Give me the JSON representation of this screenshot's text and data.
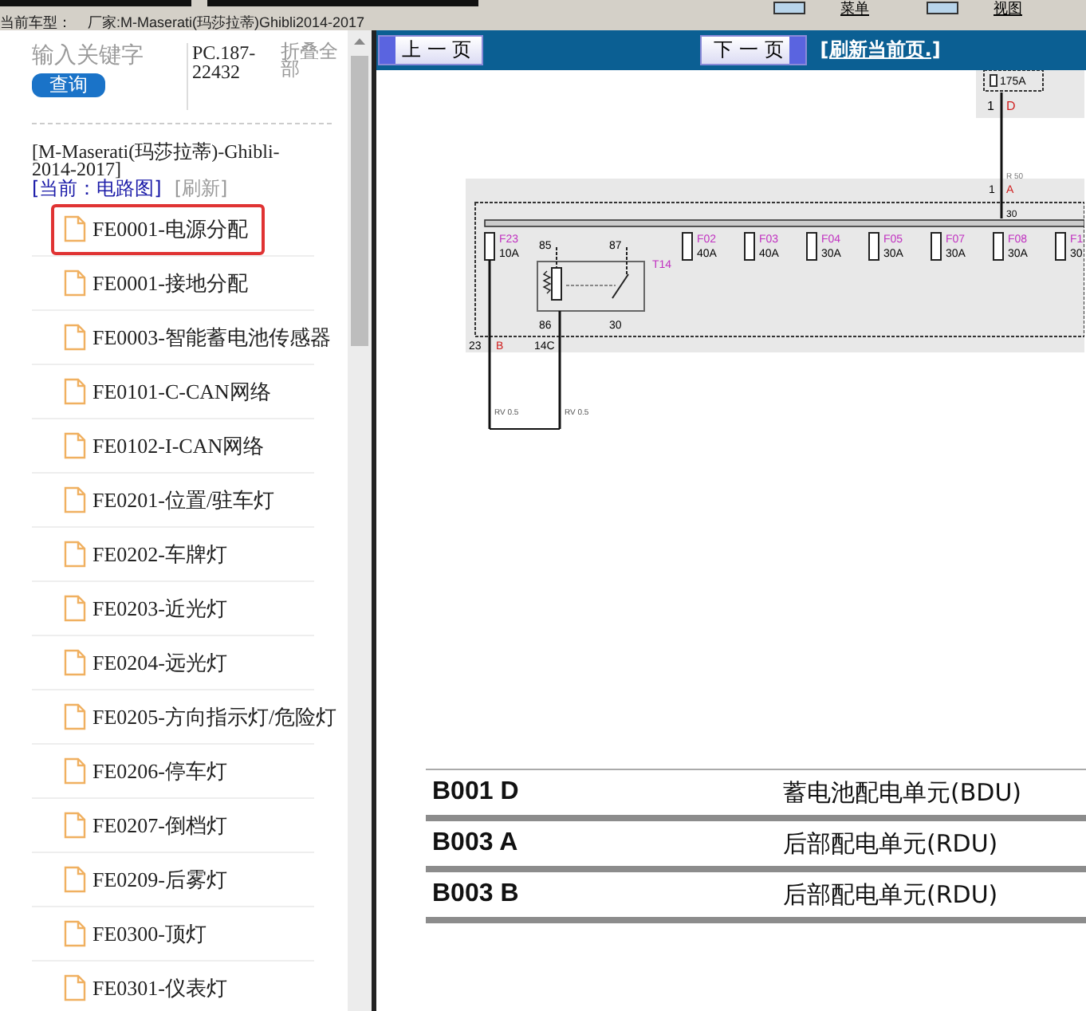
{
  "toolbar": {
    "buttons": [
      {
        "label": "菜单"
      },
      {
        "label": "视图"
      }
    ]
  },
  "vehicle_line": {
    "label": "当前车型：",
    "value": "厂家:M-Maserati(玛莎拉蒂)Ghibli2014-2017"
  },
  "sidebar": {
    "search_placeholder": "输入关键字",
    "search_button": "查询",
    "code": "PC.187-22432",
    "collapse_all": "折叠全部",
    "model_title": "[M-Maserati(玛莎拉蒂)-Ghibli-2014-2017]",
    "current": "[当前：电路图]",
    "refresh": "[刷新]",
    "items": [
      {
        "label": "FE0001-电源分配",
        "selected": true
      },
      {
        "label": "FE0001-接地分配",
        "selected": false
      },
      {
        "label": "FE0003-智能蓄电池传感器",
        "selected": false
      },
      {
        "label": "FE0101-C-CAN网络",
        "selected": false
      },
      {
        "label": "FE0102-I-CAN网络",
        "selected": false
      },
      {
        "label": "FE0201-位置/驻车灯",
        "selected": false
      },
      {
        "label": "FE0202-车牌灯",
        "selected": false
      },
      {
        "label": "FE0203-近光灯",
        "selected": false
      },
      {
        "label": "FE0204-远光灯",
        "selected": false
      },
      {
        "label": "FE0205-方向指示灯/危险灯",
        "selected": false
      },
      {
        "label": "FE0206-停车灯",
        "selected": false
      },
      {
        "label": "FE0207-倒档灯",
        "selected": false
      },
      {
        "label": "FE0209-后雾灯",
        "selected": false
      },
      {
        "label": "FE0300-顶灯",
        "selected": false
      },
      {
        "label": "FE0301-仪表灯",
        "selected": false
      }
    ]
  },
  "nav": {
    "prev": "上 一 页",
    "next": "下 一 页",
    "refresh": "[刷新当前页.]"
  },
  "diagram": {
    "supply_fuse": "175A",
    "supply_pin": "1",
    "supply_connector": "D",
    "bus_wire": "R 50",
    "bus_pin": "1",
    "bus_connector": "A",
    "bus_terminal": "30",
    "fuses": [
      {
        "name": "F23",
        "rating": "10A"
      },
      {
        "name": "F02",
        "rating": "40A"
      },
      {
        "name": "F03",
        "rating": "40A"
      },
      {
        "name": "F04",
        "rating": "30A"
      },
      {
        "name": "F05",
        "rating": "30A"
      },
      {
        "name": "F07",
        "rating": "30A"
      },
      {
        "name": "F08",
        "rating": "30A"
      },
      {
        "name": "F1",
        "rating": "30"
      }
    ],
    "relay": {
      "name": "T14",
      "pins": [
        "85",
        "87",
        "86",
        "30"
      ]
    },
    "outputs": [
      {
        "pin": "23",
        "connector": "B",
        "wire": "RV 0.5"
      },
      {
        "pin": "14C",
        "wire": "RV 0.5"
      }
    ]
  },
  "legend_table": {
    "rows": [
      {
        "code": "B001 D",
        "name": "蓄电池配电单元(BDU)"
      },
      {
        "code": "B003 A",
        "name": "后部配电单元(RDU)"
      },
      {
        "code": "B003 B",
        "name": "后部配电单元(RDU)"
      }
    ]
  }
}
